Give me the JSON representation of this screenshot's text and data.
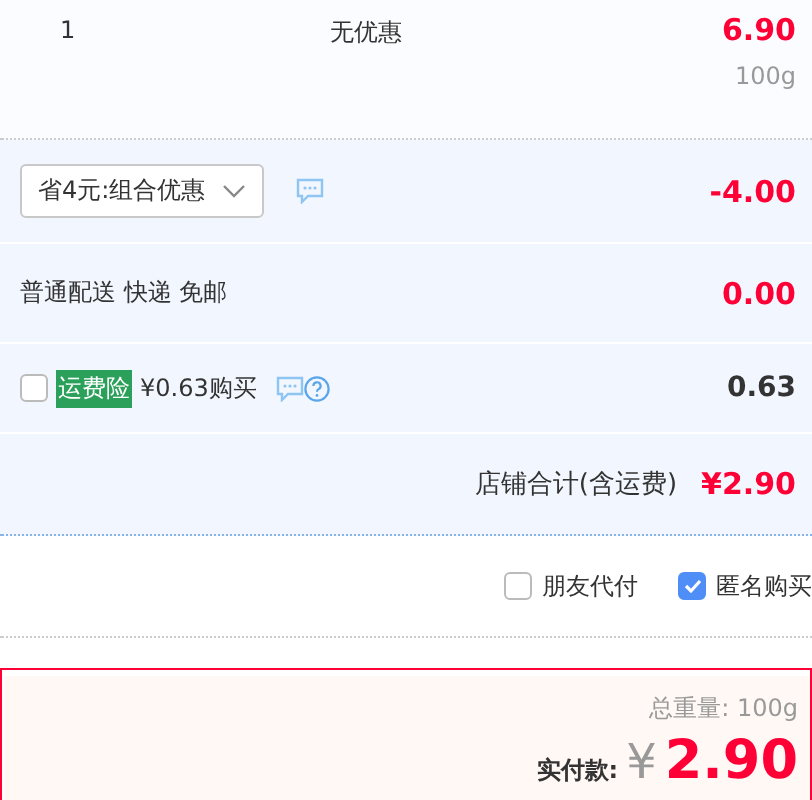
{
  "item": {
    "quantity": "1",
    "discount": "无优惠",
    "price": "6.90",
    "weight": "100g"
  },
  "promo": {
    "value": "省4元:组合优惠",
    "amount": "-4.00"
  },
  "delivery": {
    "label": "普通配送 快递 免邮",
    "amount": "0.00"
  },
  "insurance": {
    "checked": false,
    "tag": "运费险",
    "label": "¥0.63购买",
    "amount": "0.63"
  },
  "shop_total": {
    "label": "店铺合计(含运费)",
    "amount": "¥2.90"
  },
  "options": [
    {
      "label": "朋友代付",
      "checked": false
    },
    {
      "label": "匿名购买",
      "checked": true
    }
  ],
  "summary": {
    "weight_label": "总重量:",
    "weight": "100g",
    "pay_label": "实付款:",
    "currency": "¥",
    "amount": "2.90"
  }
}
